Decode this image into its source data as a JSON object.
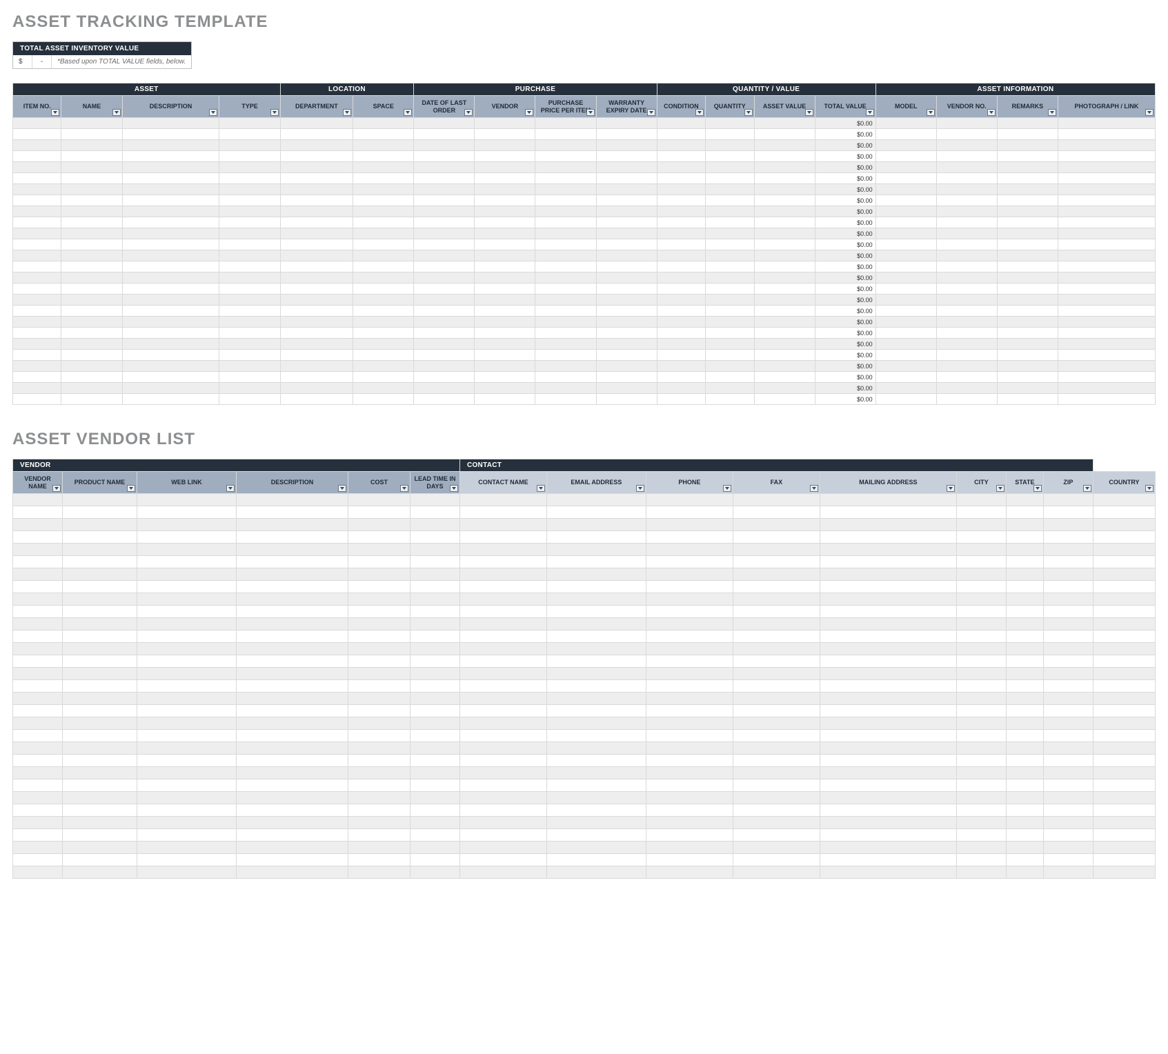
{
  "titles": {
    "asset_tracking": "ASSET TRACKING TEMPLATE",
    "asset_vendor_list": "ASSET VENDOR LIST"
  },
  "total_box": {
    "header": "TOTAL ASSET INVENTORY VALUE",
    "currency": "$",
    "dash": "-",
    "note": "*Based upon TOTAL VALUE fields, below."
  },
  "asset_table": {
    "groups": [
      {
        "label": "ASSET",
        "span": 4
      },
      {
        "label": "LOCATION",
        "span": 2
      },
      {
        "label": "PURCHASE",
        "span": 4
      },
      {
        "label": "QUANTITY / VALUE",
        "span": 4
      },
      {
        "label": "ASSET INFORMATION",
        "span": 4
      }
    ],
    "columns": [
      "ITEM NO.",
      "NAME",
      "DESCRIPTION",
      "TYPE",
      "DEPARTMENT",
      "SPACE",
      "DATE OF LAST ORDER",
      "VENDOR",
      "PURCHASE PRICE PER ITEM",
      "WARRANTY EXPIRY DATE",
      "CONDITION",
      "QUANTITY",
      "ASSET VALUE",
      "TOTAL VALUE",
      "MODEL",
      "VENDOR NO.",
      "REMARKS",
      "PHOTOGRAPH / LINK"
    ],
    "column_widths_pct": [
      4,
      5,
      8,
      5,
      6,
      5,
      5,
      5,
      5,
      5,
      4,
      4,
      5,
      5,
      5,
      5,
      5,
      8
    ],
    "total_value_index": 13,
    "rows": [
      [
        "",
        "",
        "",
        "",
        "",
        "",
        "",
        "",
        "",
        "",
        "",
        "",
        "",
        "$0.00",
        "",
        "",
        "",
        ""
      ],
      [
        "",
        "",
        "",
        "",
        "",
        "",
        "",
        "",
        "",
        "",
        "",
        "",
        "",
        "$0.00",
        "",
        "",
        "",
        ""
      ],
      [
        "",
        "",
        "",
        "",
        "",
        "",
        "",
        "",
        "",
        "",
        "",
        "",
        "",
        "$0.00",
        "",
        "",
        "",
        ""
      ],
      [
        "",
        "",
        "",
        "",
        "",
        "",
        "",
        "",
        "",
        "",
        "",
        "",
        "",
        "$0.00",
        "",
        "",
        "",
        ""
      ],
      [
        "",
        "",
        "",
        "",
        "",
        "",
        "",
        "",
        "",
        "",
        "",
        "",
        "",
        "$0.00",
        "",
        "",
        "",
        ""
      ],
      [
        "",
        "",
        "",
        "",
        "",
        "",
        "",
        "",
        "",
        "",
        "",
        "",
        "",
        "$0.00",
        "",
        "",
        "",
        ""
      ],
      [
        "",
        "",
        "",
        "",
        "",
        "",
        "",
        "",
        "",
        "",
        "",
        "",
        "",
        "$0.00",
        "",
        "",
        "",
        ""
      ],
      [
        "",
        "",
        "",
        "",
        "",
        "",
        "",
        "",
        "",
        "",
        "",
        "",
        "",
        "$0.00",
        "",
        "",
        "",
        ""
      ],
      [
        "",
        "",
        "",
        "",
        "",
        "",
        "",
        "",
        "",
        "",
        "",
        "",
        "",
        "$0.00",
        "",
        "",
        "",
        ""
      ],
      [
        "",
        "",
        "",
        "",
        "",
        "",
        "",
        "",
        "",
        "",
        "",
        "",
        "",
        "$0.00",
        "",
        "",
        "",
        ""
      ],
      [
        "",
        "",
        "",
        "",
        "",
        "",
        "",
        "",
        "",
        "",
        "",
        "",
        "",
        "$0.00",
        "",
        "",
        "",
        ""
      ],
      [
        "",
        "",
        "",
        "",
        "",
        "",
        "",
        "",
        "",
        "",
        "",
        "",
        "",
        "$0.00",
        "",
        "",
        "",
        ""
      ],
      [
        "",
        "",
        "",
        "",
        "",
        "",
        "",
        "",
        "",
        "",
        "",
        "",
        "",
        "$0.00",
        "",
        "",
        "",
        ""
      ],
      [
        "",
        "",
        "",
        "",
        "",
        "",
        "",
        "",
        "",
        "",
        "",
        "",
        "",
        "$0.00",
        "",
        "",
        "",
        ""
      ],
      [
        "",
        "",
        "",
        "",
        "",
        "",
        "",
        "",
        "",
        "",
        "",
        "",
        "",
        "$0.00",
        "",
        "",
        "",
        ""
      ],
      [
        "",
        "",
        "",
        "",
        "",
        "",
        "",
        "",
        "",
        "",
        "",
        "",
        "",
        "$0.00",
        "",
        "",
        "",
        ""
      ],
      [
        "",
        "",
        "",
        "",
        "",
        "",
        "",
        "",
        "",
        "",
        "",
        "",
        "",
        "$0.00",
        "",
        "",
        "",
        ""
      ],
      [
        "",
        "",
        "",
        "",
        "",
        "",
        "",
        "",
        "",
        "",
        "",
        "",
        "",
        "$0.00",
        "",
        "",
        "",
        ""
      ],
      [
        "",
        "",
        "",
        "",
        "",
        "",
        "",
        "",
        "",
        "",
        "",
        "",
        "",
        "$0.00",
        "",
        "",
        "",
        ""
      ],
      [
        "",
        "",
        "",
        "",
        "",
        "",
        "",
        "",
        "",
        "",
        "",
        "",
        "",
        "$0.00",
        "",
        "",
        "",
        ""
      ],
      [
        "",
        "",
        "",
        "",
        "",
        "",
        "",
        "",
        "",
        "",
        "",
        "",
        "",
        "$0.00",
        "",
        "",
        "",
        ""
      ],
      [
        "",
        "",
        "",
        "",
        "",
        "",
        "",
        "",
        "",
        "",
        "",
        "",
        "",
        "$0.00",
        "",
        "",
        "",
        ""
      ],
      [
        "",
        "",
        "",
        "",
        "",
        "",
        "",
        "",
        "",
        "",
        "",
        "",
        "",
        "$0.00",
        "",
        "",
        "",
        ""
      ],
      [
        "",
        "",
        "",
        "",
        "",
        "",
        "",
        "",
        "",
        "",
        "",
        "",
        "",
        "$0.00",
        "",
        "",
        "",
        ""
      ],
      [
        "",
        "",
        "",
        "",
        "",
        "",
        "",
        "",
        "",
        "",
        "",
        "",
        "",
        "$0.00",
        "",
        "",
        "",
        ""
      ],
      [
        "",
        "",
        "",
        "",
        "",
        "",
        "",
        "",
        "",
        "",
        "",
        "",
        "",
        "$0.00",
        "",
        "",
        "",
        ""
      ]
    ]
  },
  "vendor_table": {
    "groups": [
      {
        "label": "VENDOR",
        "span": 6,
        "align": "left"
      },
      {
        "label": "CONTACT",
        "span": 8,
        "align": "left"
      }
    ],
    "columns": [
      {
        "label": "VENDOR NAME",
        "light": false
      },
      {
        "label": "PRODUCT NAME",
        "light": false
      },
      {
        "label": "WEB LINK",
        "light": false
      },
      {
        "label": "DESCRIPTION",
        "light": false
      },
      {
        "label": "COST",
        "light": false
      },
      {
        "label": "LEAD TIME IN DAYS",
        "light": false
      },
      {
        "label": "CONTACT NAME",
        "light": true
      },
      {
        "label": "EMAIL ADDRESS",
        "light": true
      },
      {
        "label": "PHONE",
        "light": true
      },
      {
        "label": "FAX",
        "light": true
      },
      {
        "label": "MAILING ADDRESS",
        "light": true
      },
      {
        "label": "CITY",
        "light": true
      },
      {
        "label": "STATE",
        "light": true
      },
      {
        "label": "ZIP",
        "light": true
      },
      {
        "label": "COUNTRY",
        "light": true
      }
    ],
    "light_start_index": 6,
    "column_widths_pct": [
      4,
      6,
      8,
      9,
      5,
      4,
      7,
      8,
      7,
      7,
      11,
      4,
      3,
      4,
      5
    ],
    "row_count": 31
  }
}
